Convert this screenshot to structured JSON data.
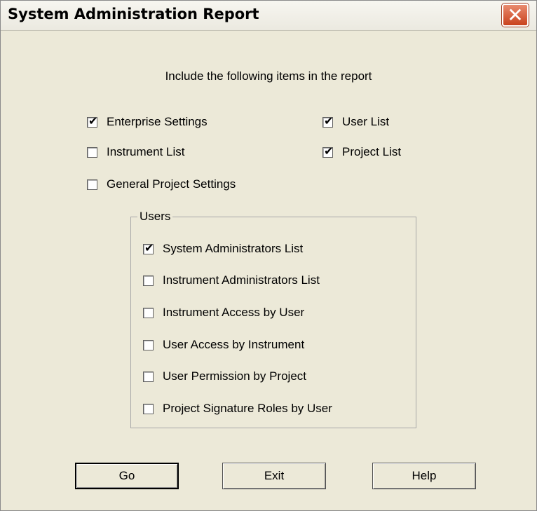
{
  "window": {
    "title": "System Administration Report",
    "close_label": "✕"
  },
  "instruction": "Include the following items in the report",
  "items": {
    "enterprise_settings": {
      "label": "Enterprise Settings",
      "checked": true
    },
    "user_list": {
      "label": "User List",
      "checked": true
    },
    "instrument_list": {
      "label": "Instrument List",
      "checked": false
    },
    "project_list": {
      "label": "Project List",
      "checked": true
    },
    "general_project_settings": {
      "label": "General Project Settings",
      "checked": false
    }
  },
  "users_group": {
    "title": "Users",
    "items": [
      {
        "label": "System Administrators List",
        "checked": true
      },
      {
        "label": "Instrument Administrators List",
        "checked": false
      },
      {
        "label": "Instrument Access by User",
        "checked": false
      },
      {
        "label": "User Access by Instrument",
        "checked": false
      },
      {
        "label": "User Permission by Project",
        "checked": false
      },
      {
        "label": "Project Signature Roles by User",
        "checked": false
      }
    ]
  },
  "buttons": {
    "go": "Go",
    "exit": "Exit",
    "help": "Help"
  },
  "check_glyph": "✔"
}
